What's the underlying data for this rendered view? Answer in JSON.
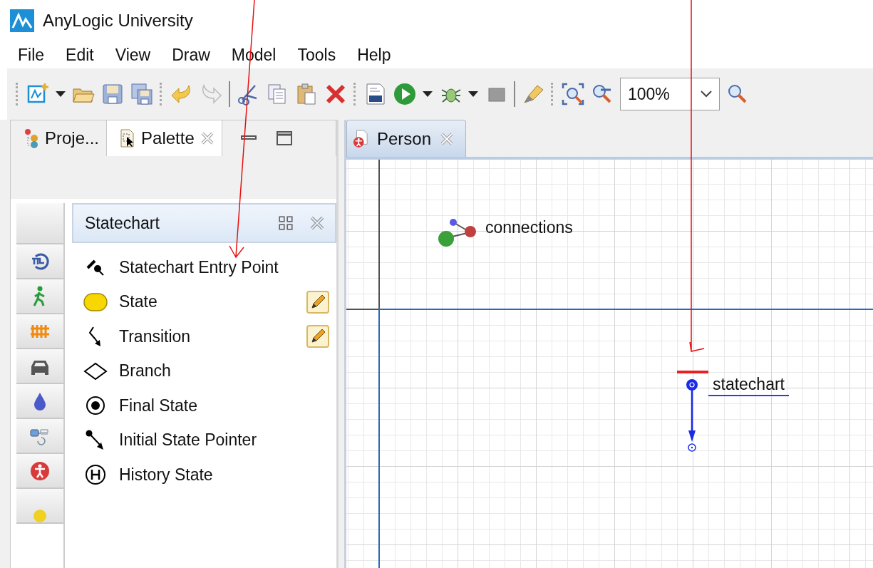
{
  "window": {
    "title": "AnyLogic University"
  },
  "menu": [
    "File",
    "Edit",
    "View",
    "Draw",
    "Model",
    "Tools",
    "Help"
  ],
  "toolbar": {
    "zoom": "100%"
  },
  "left_panel": {
    "tabs": [
      {
        "label": "Proje...",
        "selected": false
      },
      {
        "label": "Palette",
        "selected": true
      }
    ],
    "section": {
      "title": "Statechart",
      "items": [
        {
          "label": "Statechart Entry Point",
          "kind": "entry",
          "pencil": false
        },
        {
          "label": "State",
          "kind": "state",
          "pencil": true
        },
        {
          "label": "Transition",
          "kind": "transition",
          "pencil": true
        },
        {
          "label": "Branch",
          "kind": "branch",
          "pencil": false
        },
        {
          "label": "Final State",
          "kind": "final",
          "pencil": false
        },
        {
          "label": "Initial State Pointer",
          "kind": "initial",
          "pencil": false
        },
        {
          "label": "History State",
          "kind": "history",
          "pencil": false
        }
      ]
    }
  },
  "editor": {
    "tabs": [
      {
        "label": "Person",
        "selected": true
      }
    ],
    "elements": [
      {
        "kind": "connections",
        "label": "connections"
      },
      {
        "kind": "statechart",
        "label": "statechart"
      }
    ]
  }
}
